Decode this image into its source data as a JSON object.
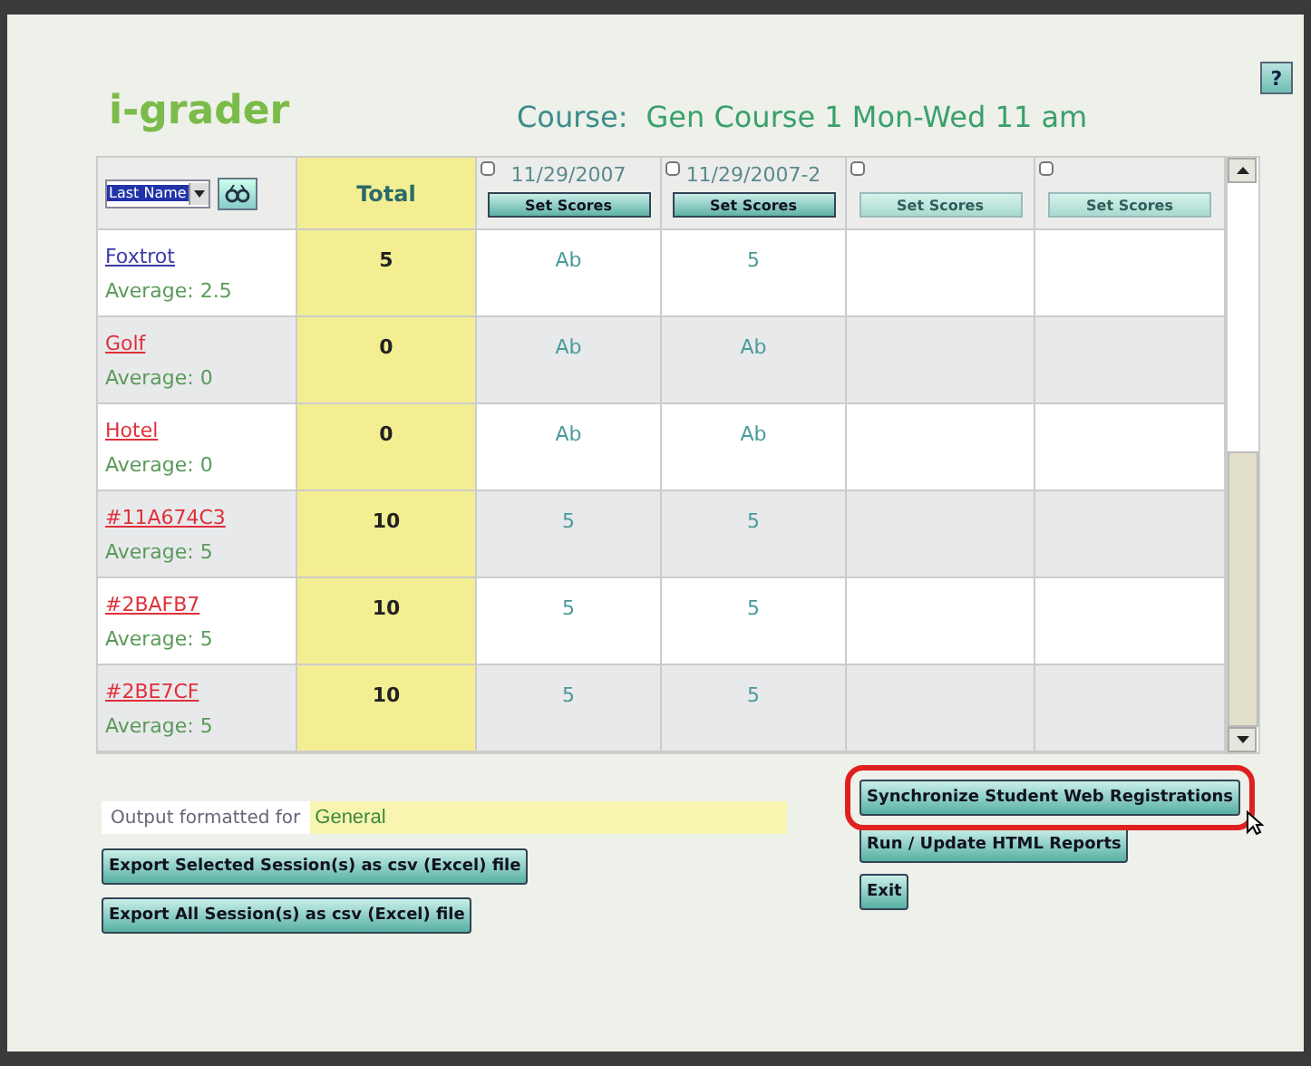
{
  "help_button": "?",
  "logo": "i-grader",
  "course": {
    "label": "Course:",
    "name": "Gen Course 1 Mon-Wed 11 am"
  },
  "table": {
    "sort_select": "Last Name",
    "total_header": "Total",
    "sessions": [
      {
        "date": "11/29/2007",
        "checked": false,
        "button": "Set Scores",
        "disabled": false
      },
      {
        "date": "11/29/2007-2",
        "checked": false,
        "button": "Set Scores",
        "disabled": false
      },
      {
        "checked": false,
        "button": "Set Scores",
        "disabled": true
      },
      {
        "checked": false,
        "button": "Set Scores",
        "disabled": true
      }
    ],
    "rows": [
      {
        "name": "Foxtrot",
        "color": "#3a3aa8",
        "average": "Average: 2.5",
        "total": "5",
        "scores": [
          "Ab",
          "5"
        ]
      },
      {
        "name": "Golf",
        "color": "#e0303a",
        "average": "Average: 0",
        "total": "0",
        "scores": [
          "Ab",
          "Ab"
        ]
      },
      {
        "name": "Hotel",
        "color": "#e0303a",
        "average": "Average: 0",
        "total": "0",
        "scores": [
          "Ab",
          "Ab"
        ]
      },
      {
        "name": "#11A674C3",
        "color": "#e0303a",
        "average": "Average: 5",
        "total": "10",
        "scores": [
          "5",
          "5"
        ]
      },
      {
        "name": "#2BAFB7",
        "color": "#e0303a",
        "average": "Average: 5",
        "total": "10",
        "scores": [
          "5",
          "5"
        ]
      },
      {
        "name": "#2BE7CF",
        "color": "#e0303a",
        "average": "Average: 5",
        "total": "10",
        "scores": [
          "5",
          "5"
        ]
      }
    ]
  },
  "output": {
    "label": "Output formatted for",
    "value": "General"
  },
  "left_buttons": [
    "Export Selected Session(s) as csv (Excel) file",
    "Export All Session(s) as csv (Excel) file"
  ],
  "right_buttons": [
    {
      "label": "Synchronize Student Web Registrations",
      "highlighted": true
    },
    {
      "label": "Run / Update HTML Reports",
      "highlighted": false
    },
    {
      "label": "Exit",
      "highlighted": false
    }
  ]
}
